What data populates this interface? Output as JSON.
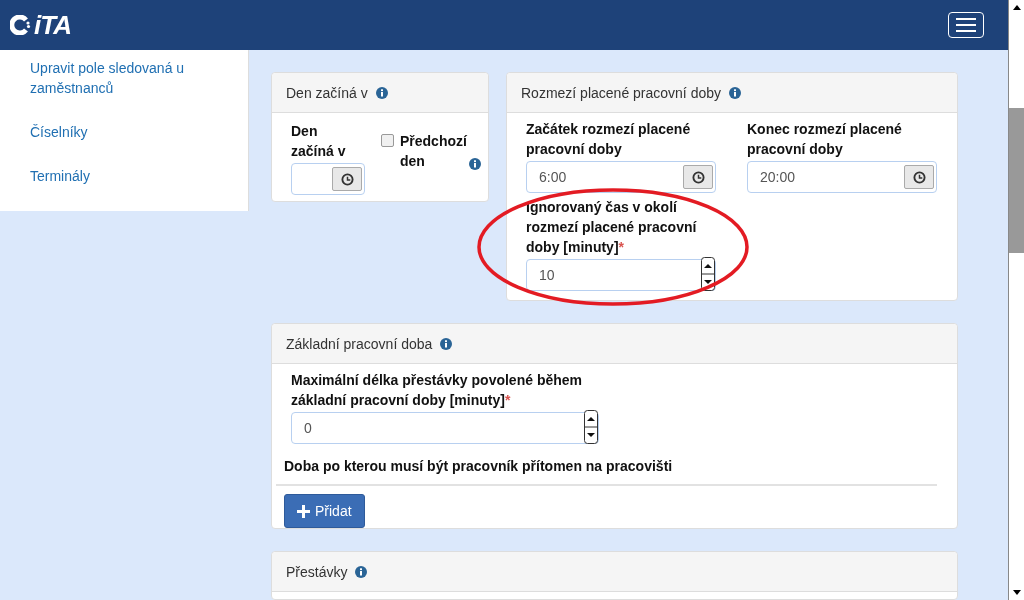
{
  "header": {
    "logo_text": "iTA"
  },
  "sidebar": {
    "items": [
      {
        "label": "Upravit pole sledovaná u zaměstnanců"
      },
      {
        "label": "Číselníky"
      },
      {
        "label": "Terminály"
      }
    ]
  },
  "day_start": {
    "title": "Den začíná v",
    "time_label": "Den začíná v",
    "previous_day": {
      "label": "Předchozí den",
      "checked": false
    }
  },
  "paid_range": {
    "title": "Rozmezí placené pracovní doby",
    "start": {
      "label": "Začátek rozmezí placené pracovní doby",
      "value": "6:00"
    },
    "end": {
      "label": "Konec rozmezí placené pracovní doby",
      "value": "20:00"
    },
    "ignored": {
      "label": "Ignorovaný čas v okolí rozmezí placené pracovní doby [minuty]",
      "required_mark": "*",
      "value": "10"
    }
  },
  "basic_time": {
    "title": "Základní pracovní doba",
    "max_break": {
      "label": "Maximální délka přestávky povolené během základní pracovní doby [minuty]",
      "required_mark": "*",
      "value": "0"
    },
    "presence_heading": "Doba po kterou musí být pracovník přítomen na pracovišti",
    "add_button": "Přidat"
  },
  "breaks": {
    "title": "Přestávky"
  }
}
